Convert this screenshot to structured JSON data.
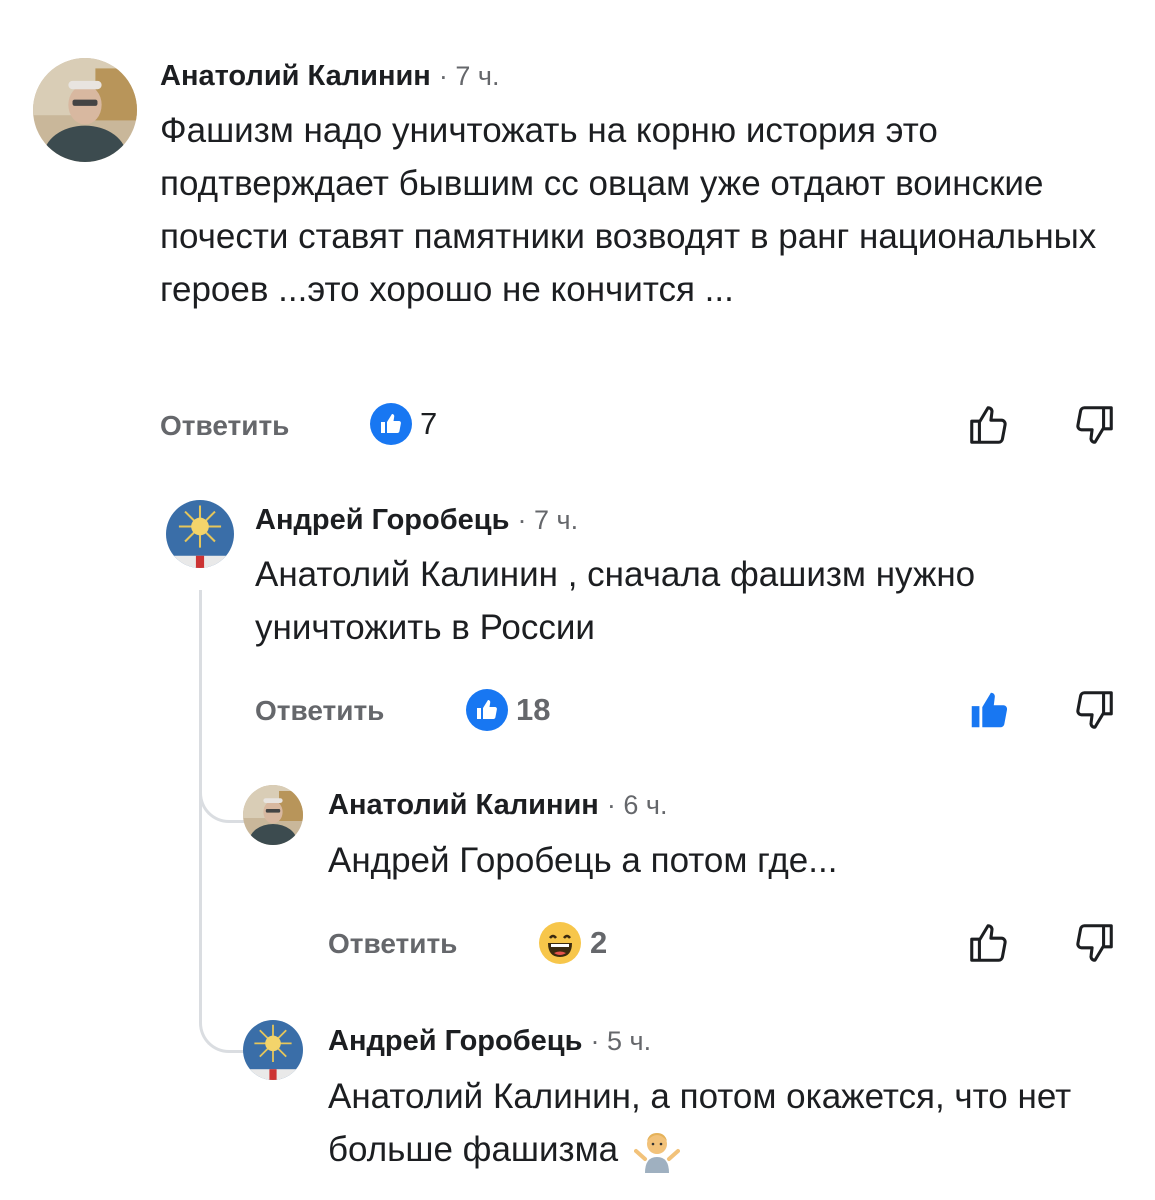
{
  "comments": [
    {
      "author": "Анатолий Калинин",
      "time": "· 7 ч.",
      "text": "Фашизм надо уничтожать на корню история это подтверждает бывшим сс овцам уже отдают воинские почести ставят памятники возводят в ранг национальных героев ...это хорошо не кончится ...",
      "reply_label": "Ответить",
      "reaction_count": "7",
      "reaction_type": "like-icon",
      "liked_by_user": false
    },
    {
      "author": "Андрей Горобець",
      "time": "· 7 ч.",
      "text": "Анатолий Калинин , сначала фашизм нужно уничтожить в России",
      "reply_label": "Ответить",
      "reaction_count": "18",
      "reaction_type": "like-icon",
      "liked_by_user": true
    },
    {
      "author": "Анатолий Калинин",
      "time": "· 6 ч.",
      "text": "Андрей Горобець а потом где...",
      "reply_label": "Ответить",
      "reaction_count": "2",
      "reaction_type": "laughing-emoji-icon",
      "liked_by_user": false
    },
    {
      "author": "Андрей Горобець",
      "time": "· 5 ч.",
      "text": "Анатолий Калинин, а потом окажется, что нет больше фашизма",
      "trailing_emoji": "person-shrugging-emoji-icon"
    }
  ],
  "colors": {
    "accent": "#1877f2",
    "secondary_text": "#65676b",
    "thread_line": "#dadde1"
  }
}
